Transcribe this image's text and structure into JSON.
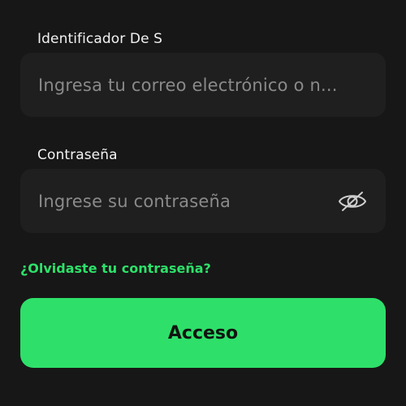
{
  "form": {
    "id_label": "Identificador De S",
    "id_placeholder": "Ingresa tu correo electrónico o n...",
    "password_label": "Contraseña",
    "password_placeholder": "Ingrese su contraseña",
    "forgot_label": "¿Olvidaste tu contraseña?",
    "submit_label": "Acceso",
    "password_toggle_icon": "eye-off-icon"
  },
  "colors": {
    "background": "#171717",
    "field_background": "#1f1f1f",
    "accent": "#2ee06a",
    "placeholder": "#8a8a8a"
  }
}
